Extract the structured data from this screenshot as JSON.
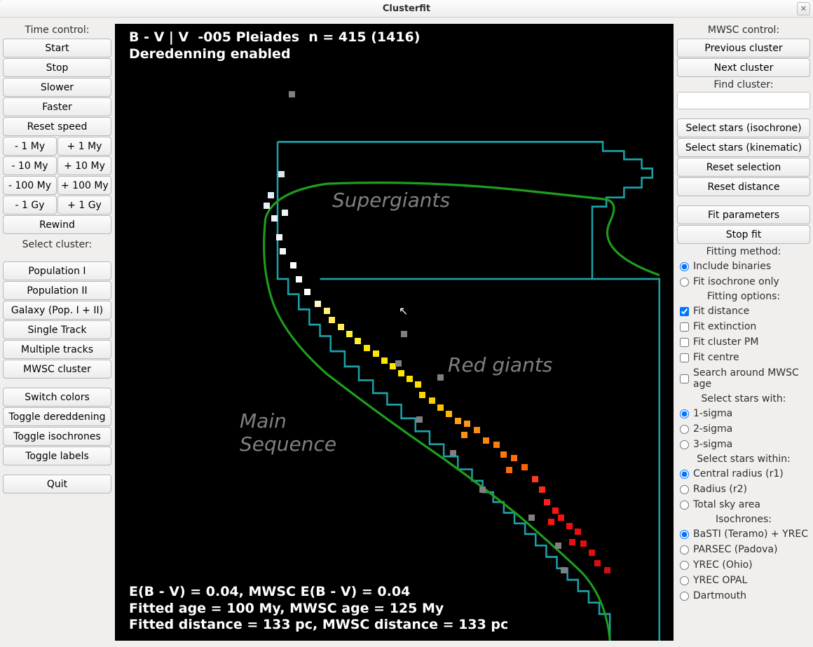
{
  "window": {
    "title": "Clusterfit"
  },
  "left": {
    "time_control_label": "Time control:",
    "start": "Start",
    "stop": "Stop",
    "slower": "Slower",
    "faster": "Faster",
    "reset_speed": "Reset speed",
    "minus_1my": "- 1 My",
    "plus_1my": "+ 1 My",
    "minus_10my": "- 10 My",
    "plus_10my": "+ 10 My",
    "minus_100my": "- 100 My",
    "plus_100my": "+ 100 My",
    "minus_1gy": "- 1 Gy",
    "plus_1gy": "+ 1 Gy",
    "rewind": "Rewind",
    "select_cluster_label": "Select cluster:",
    "population1": "Population I",
    "population2": "Population II",
    "galaxy": "Galaxy (Pop. I + II)",
    "single_track": "Single Track",
    "multiple_tracks": "Multiple tracks",
    "mwsc_cluster": "MWSC cluster",
    "switch_colors": "Switch colors",
    "toggle_dereddening": "Toggle dereddening",
    "toggle_isochrones": "Toggle isochrones",
    "toggle_labels": "Toggle labels",
    "quit": "Quit"
  },
  "right": {
    "mwsc_control_label": "MWSC control:",
    "previous_cluster": "Previous cluster",
    "next_cluster": "Next cluster",
    "find_cluster_label": "Find cluster:",
    "find_cluster_value": "",
    "select_stars_isochrone": "Select stars (isochrone)",
    "select_stars_kinematic": "Select stars (kinematic)",
    "reset_selection": "Reset selection",
    "reset_distance": "Reset distance",
    "fit_parameters": "Fit parameters",
    "stop_fit": "Stop fit",
    "fitting_method_label": "Fitting method:",
    "include_binaries": "Include binaries",
    "fit_isochrone_only": "Fit isochrone only",
    "fitting_options_label": "Fitting options:",
    "fit_distance": "Fit distance",
    "fit_extinction": "Fit extinction",
    "fit_cluster_pm": "Fit cluster PM",
    "fit_centre": "Fit centre",
    "search_around_mwsc_age": "Search around MWSC age",
    "select_stars_with_label": "Select stars with:",
    "sigma1": "1-sigma",
    "sigma2": "2-sigma",
    "sigma3": "3-sigma",
    "select_stars_within_label": "Select stars within:",
    "central_radius": "Central radius (r1)",
    "radius": "Radius (r2)",
    "total_sky_area": "Total sky area",
    "isochrones_label": "Isochrones:",
    "basti": "BaSTI (Teramo) + YREC",
    "parsec": "PARSEC (Padova)",
    "yrec_ohio": "YREC (Ohio)",
    "yrec_opal": "YREC OPAL",
    "dartmouth": "Dartmouth"
  },
  "plot": {
    "top_line1": "B - V | V  -005 Pleiades  n = 415 (1416)",
    "top_line2": "Deredenning enabled",
    "label_supergiants": "Supergiants",
    "label_red_giants": "Red giants",
    "label_main_sequence": "Main\nSequence",
    "bottom_line1": "E(B - V) = 0.04, MWSC E(B - V) = 0.04",
    "bottom_line2": "Fitted age = 100 My, MWSC age = 125 My",
    "bottom_line3": "Fitted distance = 133 pc, MWSC distance = 133 pc"
  }
}
